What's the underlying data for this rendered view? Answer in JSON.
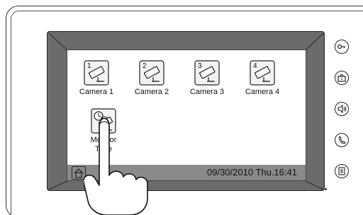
{
  "screen": {
    "tiles": [
      {
        "number": "1",
        "label": "Camera 1",
        "icon": "camera-icon"
      },
      {
        "number": "2",
        "label": "Camera 2",
        "icon": "camera-icon"
      },
      {
        "number": "3",
        "label": "Camera 3",
        "icon": "camera-icon"
      },
      {
        "number": "4",
        "label": "Camera 4",
        "icon": "camera-icon"
      },
      {
        "number": "",
        "label_line1": "Monitor",
        "label_line2": "Time",
        "icon": "monitor-time-icon"
      }
    ],
    "status_bar": {
      "datetime": "09/30/2010  Thu.16:41",
      "home_icon": "home-icon"
    }
  },
  "side_buttons": [
    {
      "icon": "key-icon"
    },
    {
      "icon": "intercom-icon"
    },
    {
      "icon": "speaker-icon"
    },
    {
      "icon": "handset-icon"
    },
    {
      "icon": "menu-icon"
    }
  ],
  "overlay": {
    "icon": "pointing-hand-icon"
  }
}
